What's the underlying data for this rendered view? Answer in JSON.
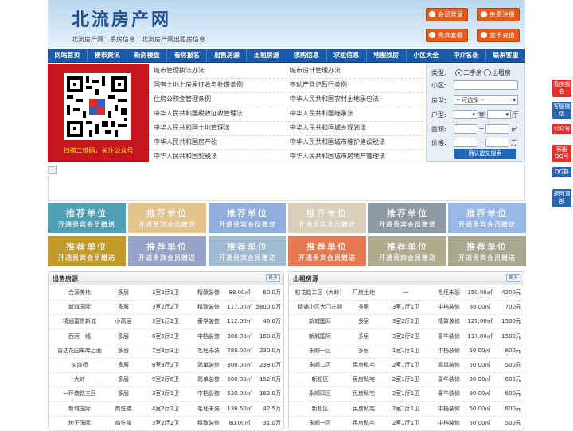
{
  "header": {
    "logo": "北流房产网",
    "subtitle": "北流房产网二手房信息　北流房产网出租房信息",
    "buttons": {
      "login": "会员登录",
      "register": "免费注册",
      "vip": "贵宾套餐",
      "recharge": "金币充值"
    }
  },
  "nav": [
    "网站首页",
    "楼市资讯",
    "新房楼盘",
    "看房报名",
    "出售房源",
    "出租房源",
    "求购信息",
    "求租信息",
    "地图找房",
    "小区大全",
    "中介名录",
    "联系客服"
  ],
  "qr": {
    "caption": "扫描二维码，关注公众号"
  },
  "laws": [
    [
      "城市管理执法办法",
      "城市设计管理办法"
    ],
    [
      "国有土地上房屋征收与补偿条例",
      "不动产登记暂行条例"
    ],
    [
      "住房公积金管理条例",
      "中华人民共和国农村土地承包法"
    ],
    [
      "中华人民共和国税收征收管理法",
      "中华人民共和国继承法"
    ],
    [
      "中华人民共和国土地管理法",
      "中华人民共和国城乡规划法"
    ],
    [
      "中华人民共和国房产税",
      "中华人民共和国城市维护建设税法"
    ],
    [
      "中华人民共和国契税法",
      "中华人民共和国城市房地产管理法"
    ]
  ],
  "search": {
    "type_label": "类型:",
    "type_options": [
      "二手房",
      "出租房"
    ],
    "community_label": "小区:",
    "house_type_label": "房型:",
    "house_type_value": "-- 可选择 --",
    "layout_label": "户型:",
    "room_unit": "室",
    "hall_unit": "厅",
    "area_label": "面积:",
    "area_unit": "㎡",
    "price_label": "价格:",
    "price_unit": "万",
    "range_sep": "~",
    "submit": "确认提交搜索"
  },
  "ads": {
    "title": "推荐单位",
    "subtitle": "开通贵宾会员赠送",
    "colors": [
      "#4fa1b4",
      "#e3c58c",
      "#8faede",
      "#d9cfba",
      "#8e9aa3",
      "#97b8e8",
      "#c49a2b",
      "#96a3c6",
      "#9fbad1",
      "#e8784d",
      "#b2aa8e",
      "#aaa78f"
    ]
  },
  "sale": {
    "title": "出售房源",
    "more": "更多",
    "rows": [
      [
        "合源美地",
        "多层",
        "3室2厅1卫",
        "精致装修",
        "88.00㎡",
        "60.0万"
      ],
      [
        "新城国际",
        "多层",
        "3室2厅2卫",
        "精致装修",
        "117.00㎡",
        "5800.0万"
      ],
      [
        "精通富贵新城",
        "小高层",
        "3室1厅2卫",
        "豪华装修",
        "112.00㎡",
        "46.0万"
      ],
      [
        "西河一线",
        "多层",
        "6室3厅3卫",
        "中档装修",
        "388.00㎡",
        "180.0万"
      ],
      [
        "富达花园车库后面",
        "多层",
        "7室3厅3卫",
        "毛坯未装",
        "780.00㎡",
        "230.0万"
      ],
      [
        "火烧桥",
        "多层",
        "8室3厅3卫",
        "简单装修",
        "800.00㎡",
        "238.0万"
      ],
      [
        "大岭",
        "多层",
        "9室2厅6卫",
        "简单装修",
        "600.00㎡",
        "152.0万"
      ],
      [
        "一环南路三区",
        "多层",
        "3室2厅1卫",
        "中档装修",
        "520.00㎡",
        "162.0万"
      ],
      [
        "新城国际",
        "商住楼",
        "4室2厅2卫",
        "毛坯未装",
        "136.50㎡",
        "42.5万"
      ],
      [
        "地王国际",
        "商住楼",
        "3室2厅2卫",
        "精致装修",
        "80.00㎡",
        "31.0万"
      ]
    ]
  },
  "rent": {
    "title": "出租房源",
    "more": "更多",
    "rows": [
      [
        "松花路二区（大岭）",
        "厂房土地",
        "一",
        "毛坯未装",
        "350.00㎡",
        "4200元"
      ],
      [
        "精通小区大门左侧",
        "多层",
        "3室1厅1卫",
        "中档装修",
        "88.00㎡",
        "700元"
      ],
      [
        "新城国际",
        "多层",
        "3室2厅2卫",
        "精致装修",
        "127.00㎡",
        "1500元"
      ],
      [
        "新城国际",
        "多层",
        "3室2厅2卫",
        "豪华装修",
        "117.00㎡",
        "1500元"
      ],
      [
        "永顺一区",
        "多层",
        "1室1厅1卫",
        "中档装修",
        "50.00㎡",
        "600元"
      ],
      [
        "永顺二区",
        "民房私宅",
        "2室1厅1卫",
        "简单装修",
        "50.00㎡",
        "500元"
      ],
      [
        "新松区",
        "民房私宅",
        "2室1厅1卫",
        "豪华装修",
        "80.00㎡",
        "600元"
      ],
      [
        "永顺四区",
        "民房私宅",
        "2室1厅1卫",
        "豪华装修",
        "80.00㎡",
        "600元"
      ],
      [
        "新松区",
        "民房私宅",
        "2室1厅1卫",
        "中档装修",
        "50.00㎡",
        "600元"
      ],
      [
        "永顺一区",
        "民房私宅",
        "2室1厅1卫",
        "中档装修",
        "50.00㎡",
        "500元"
      ]
    ]
  },
  "side": [
    "看房报名",
    "客服微信",
    "公众号",
    "客服QQ号",
    "QQ群",
    "返回顶部"
  ]
}
